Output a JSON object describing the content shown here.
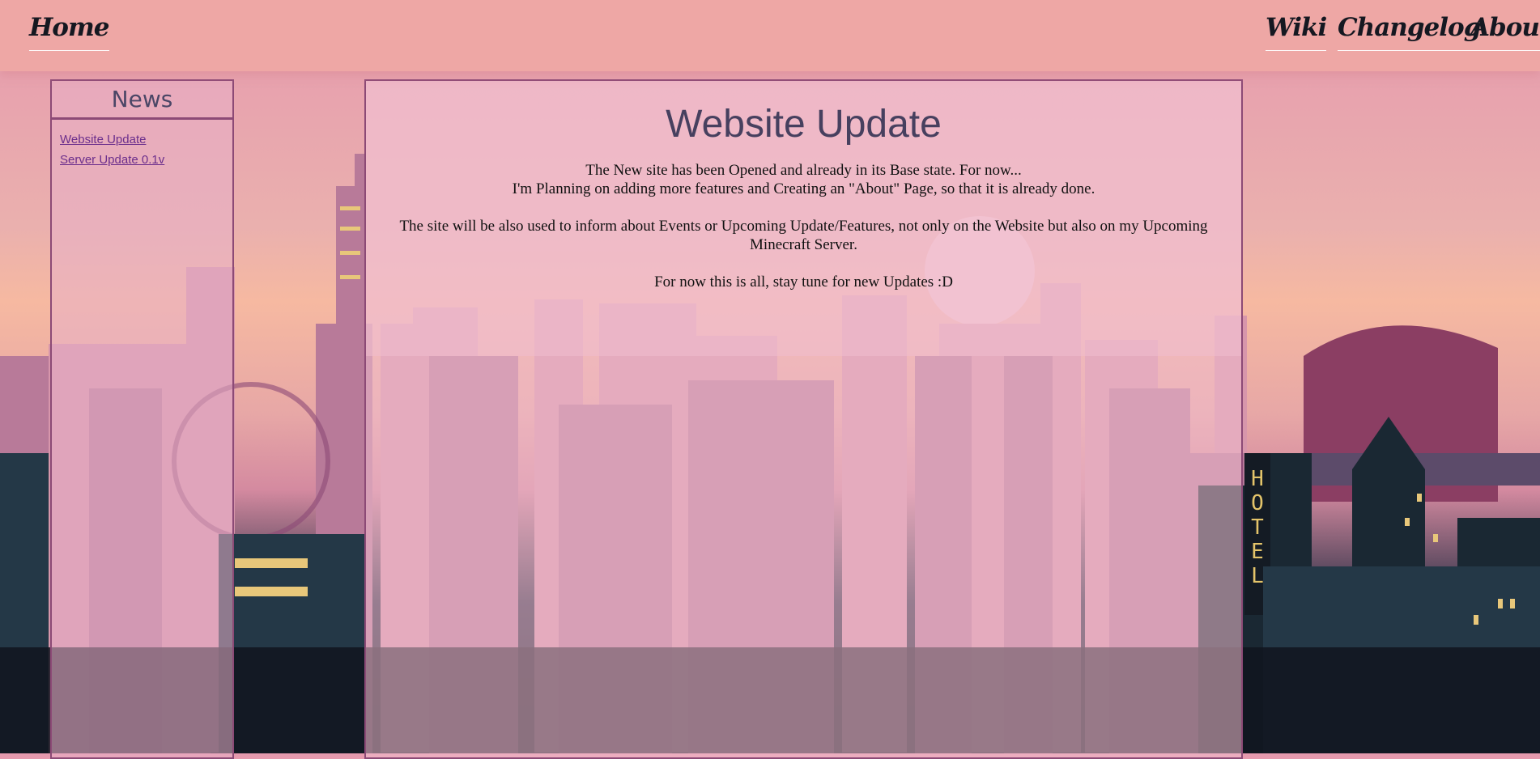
{
  "nav": {
    "home": "Home",
    "wiki": "Wiki",
    "changelog": "Changelog",
    "about": "About"
  },
  "news": {
    "title": "News",
    "items": [
      {
        "label": "Website Update"
      },
      {
        "label": "Server Update 0.1v"
      }
    ]
  },
  "article": {
    "title": "Website Update",
    "line1": "The New site has been Opened and already in its Base state. For now...",
    "line2": "I'm Planning on adding more features and Creating an \"About\" Page, so that it is already done.",
    "paragraph2": "The site will be also used to inform about Events or Upcoming Update/Features, not only on the Website but also on my Upcoming Minecraft Server.",
    "paragraph3": "For now this is all, stay tune for new Updates :D"
  },
  "hotel_sign": "HOTEL",
  "colors": {
    "accent": "#8c4a76",
    "topbar": "#eea7a5",
    "link": "#6b2e8c"
  }
}
